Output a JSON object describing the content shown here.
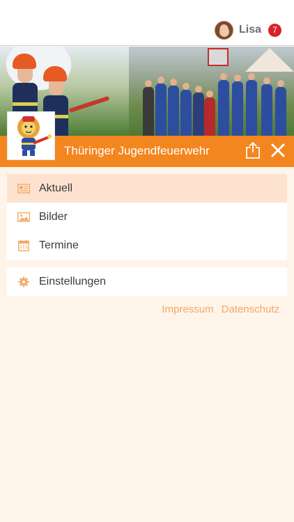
{
  "header": {
    "user_name": "Lisa",
    "notification_count": "7"
  },
  "titlebar": {
    "title": "Thüringer Jugendfeuerwehr"
  },
  "menu": {
    "items": [
      {
        "label": "Aktuell",
        "icon": "newspaper-icon",
        "active": true
      },
      {
        "label": "Bilder",
        "icon": "image-icon",
        "active": false
      },
      {
        "label": "Termine",
        "icon": "calendar-icon",
        "active": false
      }
    ],
    "settings": {
      "label": "Einstellungen",
      "icon": "gear-icon"
    }
  },
  "footer": {
    "links": [
      "Impressum",
      "Datenschutz"
    ]
  },
  "colors": {
    "accent": "#f3861f",
    "active_row": "#fde3cf",
    "link": "#f2a867",
    "background": "#fef4ea",
    "badge": "#d8232a"
  }
}
